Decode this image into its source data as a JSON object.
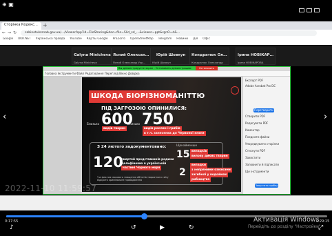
{
  "zoom_bar": {
    "left_label": "⊕ ▣"
  },
  "browser": {
    "tab_title": "Сторінка Кодекс гр…",
    "address": "cabinetukrsnab.gov.ua/…/ViewerApp?id=FileSharing&doc=file=Slid_sd_…&viewer=ppt&rgnO=d&…",
    "bookmarks": [
      "Google",
      "UKR.NET",
      "Українська правда",
      "YouTube",
      "Карты Google",
      "ProZorro",
      "OpenStreetMap",
      "Telegram",
      "Новини",
      "Дія",
      "Офіс"
    ]
  },
  "participants": [
    {
      "name": "Galyna Minicheva",
      "sub": "Galyna Minicheva"
    },
    {
      "name": "Ясний Олександр Укра…",
      "sub": "Ясний Олександр Укр…"
    },
    {
      "name": "Юрій Шовкун",
      "sub": "Юрій Шовкун"
    },
    {
      "name": "Кондратюк Олександр",
      "sub": "Кондратюк Олександр"
    },
    {
      "name": "Ірина НОВІКАРОВА",
      "sub": "Ірина НОВІКАРОВА"
    }
  ],
  "share": {
    "banner": "Вы демонстрируете экран - Остановить демонстрацию",
    "stop": "Остановить"
  },
  "pdf_toolbar": "Головна  Інструменти  Файл  Редагування  Перегляд  Вікно  Довідка",
  "slide": {
    "title": "ШКОДА БІОРІЗНОМАНІТТЮ",
    "danger_heading": "ПІД ЗАГРОЗОЮ ОПИНИЛИСЯ:",
    "left_prefix": "Близько",
    "left_value": "600",
    "left_label": "видів тварин",
    "right_prefix": "Близько",
    "right_value": "750",
    "right_label_1": "видів рослин і грибів",
    "right_label_2": "в т.ч. занесених до Червоної книги",
    "since_heading": "З 24 лютого задокументовано:",
    "big_value": "120",
    "big_label_1": "смертей представників родини",
    "big_label_2": "дельфінових в українській",
    "big_label_3": "частині Чорного моря",
    "footnote": "*за фактом масового знищення об'єктів тваринного світу відкрито кримінальне провадження",
    "extra_heading": "Щонайменше",
    "fact_a_value": "15",
    "fact_a_text_1": "випадків",
    "fact_a_text_2": "вилову диких тварин",
    "fact_b_value": "2",
    "fact_b_text_1": "випадки",
    "fact_b_text_2": "з непрямими ознаками",
    "fact_b_text_3": "загибелі у водоймах",
    "fact_b_text_4": "рибництва"
  },
  "right_panel": {
    "items": [
      "Експорт PDF",
      "Adobe Acrobat Pro DC",
      "Створити PDF",
      "Редагувати PDF",
      "Коментар",
      "Поєднати файли",
      "Упорядкувати сторінки",
      "Стиснути PDF",
      "Захистити",
      "Заповнити й підписати",
      "Ще інструменти"
    ],
    "button": "Перетворити",
    "bottom_button": "Запустити пробну"
  },
  "watermark_time": "2022-11-10 11:59:57",
  "player": {
    "current": "0:17:55",
    "total": "0:29:15",
    "progress": 0.43
  },
  "activation": {
    "line1": "Активація Windows",
    "line2": "Перейдіть до розділу \"Настройки\""
  },
  "colors": {
    "accent_red": "#e03a36",
    "share_green": "#2ecc40",
    "progress_blue": "#2b83ff"
  }
}
